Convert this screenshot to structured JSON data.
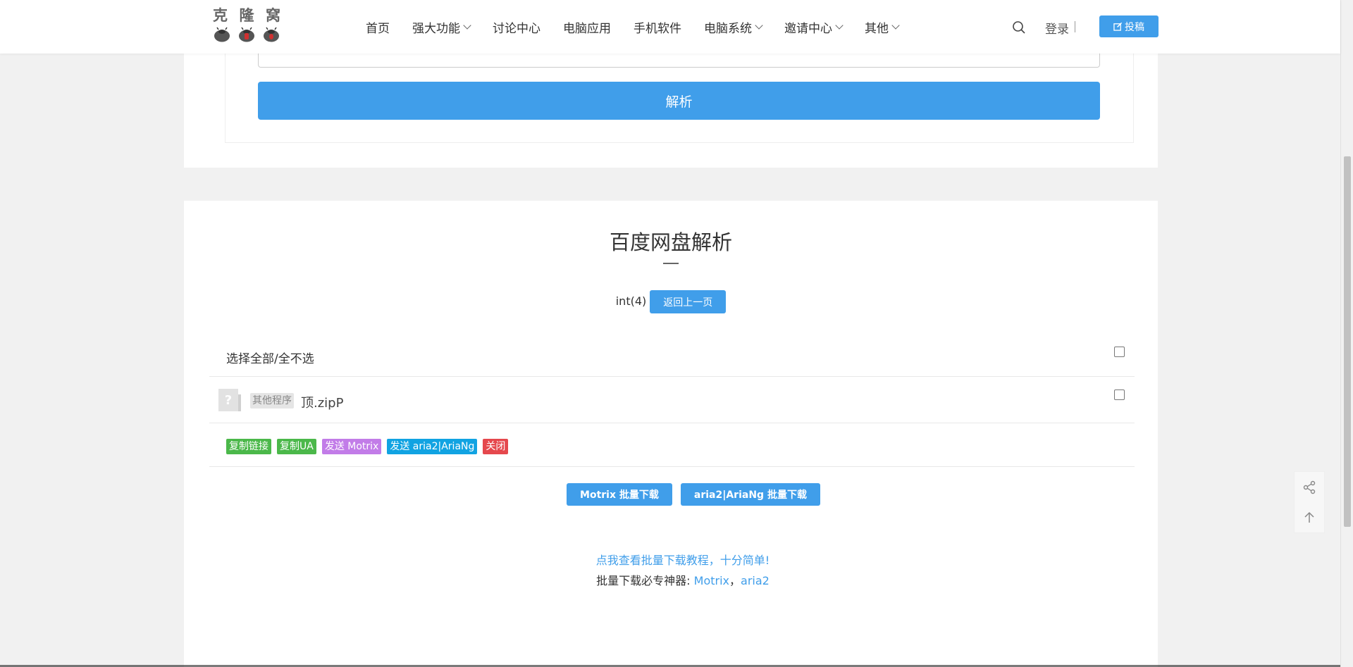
{
  "header": {
    "logo_text": [
      "克",
      "隆",
      "窝"
    ],
    "nav": [
      {
        "label": "首页",
        "dropdown": false
      },
      {
        "label": "强大功能",
        "dropdown": true
      },
      {
        "label": "讨论中心",
        "dropdown": false
      },
      {
        "label": "电脑应用",
        "dropdown": false
      },
      {
        "label": "手机软件",
        "dropdown": false
      },
      {
        "label": "电脑系统",
        "dropdown": true
      },
      {
        "label": "邀请中心",
        "dropdown": true
      },
      {
        "label": "其他",
        "dropdown": true
      }
    ],
    "login_label": "登录",
    "post_label": "投稿"
  },
  "parse_form": {
    "parse_button": "解析"
  },
  "result": {
    "title": "百度网盘解析",
    "status": "int(4)",
    "back_button": "返回上一页",
    "select_all_label": "选择全部/全不选",
    "file": {
      "tag": "其他程序",
      "name": "顶.zipP"
    },
    "actions": [
      {
        "label": "复制链接",
        "color": "#4bb84a"
      },
      {
        "label": "复制UA",
        "color": "#4bb84a"
      },
      {
        "label": "发送 Motrix",
        "color": "#c27ce8"
      },
      {
        "label": "发送 aria2|AriaNg",
        "color": "#11a3e2"
      },
      {
        "label": "关闭",
        "color": "#e5484d"
      }
    ],
    "batch_motrix": "Motrix 批量下载",
    "batch_aria2": "aria2|AriaNg 批量下载",
    "tutorial_link": "点我查看批量下载教程，十分简单!",
    "tools_label": "批量下载必专神器: ",
    "tool_motrix": "Motrix",
    "tool_sep": "，",
    "tool_aria2": "aria2"
  },
  "colors": {
    "accent": "#409eea"
  }
}
